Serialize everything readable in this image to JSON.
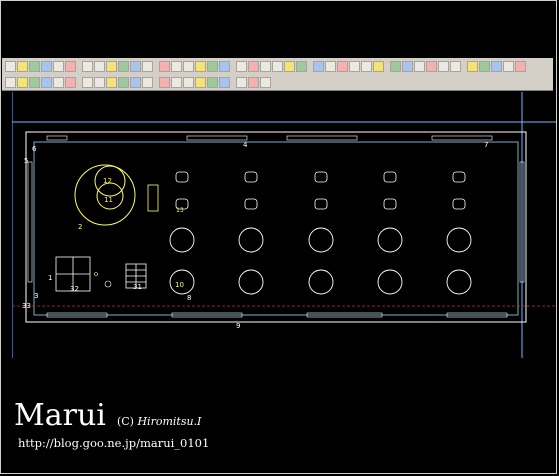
{
  "toolbar": {
    "row1": [
      "new",
      "open",
      "save",
      "print",
      "undo",
      "redo",
      "cut",
      "copy",
      "paste",
      "match",
      "line",
      "polyline",
      "circle",
      "arc",
      "rect",
      "text",
      "dim",
      "hatch",
      "block",
      "insert",
      "move",
      "copy2",
      "rotate",
      "scale",
      "mirror",
      "offset",
      "trim",
      "extend",
      "layer",
      "color",
      "ltype",
      "snap",
      "grid",
      "ortho",
      "zoom",
      "zoom-in",
      "zoom-out",
      "pan",
      "zoom-all",
      "redraw",
      "help"
    ],
    "row2": [
      "osnap",
      "end",
      "mid",
      "cen",
      "int",
      "perp",
      "tan",
      "near",
      "quad",
      "node",
      "ins",
      "app",
      "ext",
      "par",
      "none",
      "dist",
      "area",
      "list",
      "id",
      "props",
      "match-props"
    ]
  },
  "drawing": {
    "labels": {
      "l12": "12",
      "l11": "11",
      "l2": "2",
      "l13": "13",
      "l10": "10",
      "l32": "32",
      "l31": "31",
      "l1": "1",
      "l3": "3",
      "l6": "6",
      "l5": "5",
      "l4": "4",
      "l7": "7",
      "l8": "8",
      "l9": "9",
      "l33": "33"
    }
  },
  "watermark": {
    "name": "Marui",
    "copyright_mark": "(C)",
    "author": "Hiromitsu.I",
    "url": "http://blog.goo.ne.jp/marui_0101"
  },
  "colors": {
    "background": "#000000",
    "toolbar": "#d4d0c8",
    "outline": "#ffffff",
    "yellow_entities": "#ffff66",
    "frame_lines": "#6fb7ff",
    "center_line": "#c03030"
  }
}
